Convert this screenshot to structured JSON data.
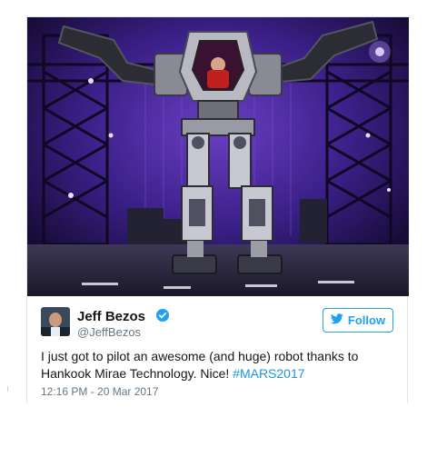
{
  "tweet": {
    "author": {
      "name": "Jeff Bezos",
      "handle": "@JeffBezos",
      "verified": true
    },
    "follow_label": "Follow",
    "text_main": "I just got to pilot an awesome (and huge) robot thanks to Hankook Mirae Technology. Nice! ",
    "hashtag": "#MARS2017",
    "timestamp": "12:16 PM - 20 Mar 2017"
  },
  "colors": {
    "accent": "#1da1f2",
    "link": "#1b95e0",
    "text": "#14171a",
    "muted": "#657786",
    "border": "#e1e8ed"
  },
  "icons": {
    "verified": "verified-badge-icon",
    "follow": "twitter-bird-icon"
  }
}
